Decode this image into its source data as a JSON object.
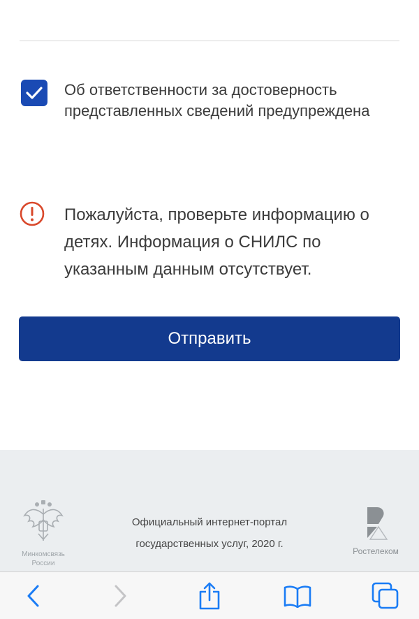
{
  "consent": {
    "checked": true,
    "label": "Об ответственности за достоверность представленных сведений предупреждена"
  },
  "alert": {
    "icon": "alert-circle-icon",
    "message": "Пожалуйста, проверьте информацию о детях. Информация о СНИЛС по указанным данным отсутствует."
  },
  "submit_label": "Отправить",
  "footer": {
    "ministry": "Минкомсвязь России",
    "portal_line1": "Официальный интернет-портал",
    "portal_line2": "государственных услуг, 2020 г.",
    "partner": "Ростелеком"
  },
  "toolbar": {
    "buttons": [
      "back-icon",
      "forward-icon",
      "share-icon",
      "bookmarks-icon",
      "tabs-icon"
    ]
  },
  "colors": {
    "accent": "#133a8e",
    "checkbox": "#1a4ab4",
    "alert": "#d9482b",
    "ios_blue": "#1a7cf5",
    "disabled": "#c4c4c6"
  }
}
